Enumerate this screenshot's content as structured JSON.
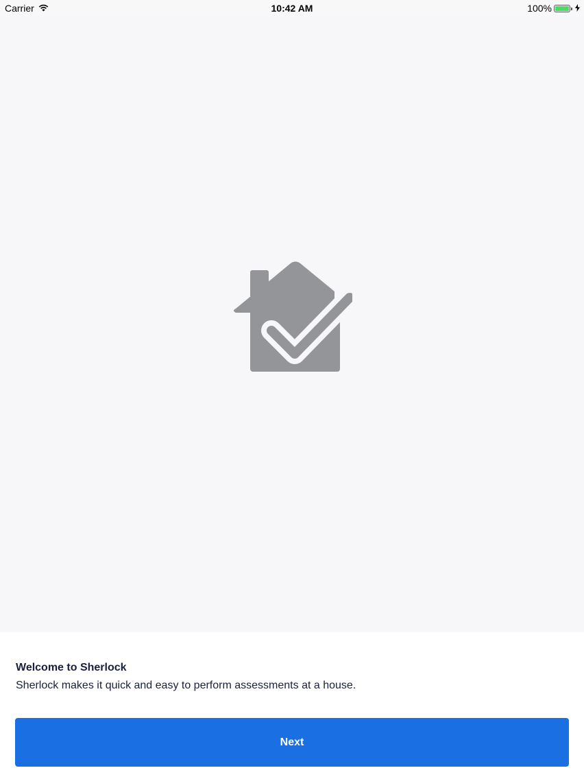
{
  "status_bar": {
    "carrier": "Carrier",
    "time": "10:42 AM",
    "battery_percent": "100%",
    "battery_level": 1.0,
    "icons": [
      "wifi-icon",
      "battery-icon",
      "charging-bolt-icon"
    ]
  },
  "hero": {
    "icon": "house-check-icon",
    "icon_color": "#939598"
  },
  "welcome": {
    "title": "Welcome to Sherlock",
    "body": "Sherlock makes it quick and easy to perform assessments at a house."
  },
  "actions": {
    "next_label": "Next",
    "accent_color": "#1a6fe3"
  }
}
